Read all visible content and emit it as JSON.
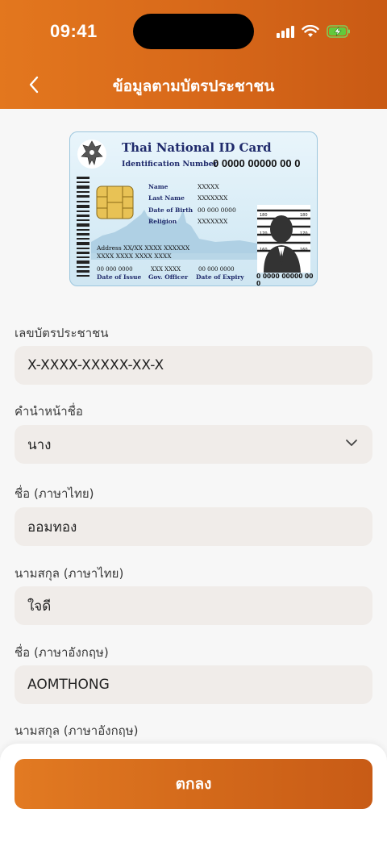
{
  "status_bar": {
    "time": "09:41"
  },
  "header": {
    "title": "ข้อมูลตามบัตรประชาชน"
  },
  "id_card": {
    "title": "Thai National ID Card",
    "id_label": "Identification Number",
    "id_number": "0 0000 00000 00 0",
    "name_label": "Name",
    "name_value": "XXXXX",
    "lastname_label": "Last Name",
    "lastname_value": "XXXXXXX",
    "dob_label": "Date of Birth",
    "dob_value": "00 000 0000",
    "religion_label": "Religion",
    "religion_value": "XXXXXXX",
    "address_line1": "Address XX/XX XXXX XXXXXX",
    "address_line2": "XXXX XXXX XXXX XXXX",
    "issue_value": "00 000 0000",
    "issue_label": "Date of Issue",
    "officer_value": "XXX XXXX",
    "officer_label": "Gov. Officer",
    "expiry_value": "00 000 0000",
    "expiry_label": "Date of Expiry",
    "bottom_number": "0 0000 00000 00 0",
    "height_marks": [
      "180",
      "180",
      "170",
      "170",
      "160",
      "160"
    ]
  },
  "form": {
    "id_number_label": "เลขบัตรประชาชน",
    "id_number_value": "X-XXXX-XXXXX-XX-X",
    "prefix_label": "คำนำหน้าชื่อ",
    "prefix_value": "นาง",
    "firstname_th_label": "ชื่อ (ภาษาไทย)",
    "firstname_th_value": "ออมทอง",
    "lastname_th_label": "นามสกุล (ภาษาไทย)",
    "lastname_th_value": "ใจดี",
    "firstname_en_label": "ชื่อ (ภาษาอังกฤษ)",
    "firstname_en_value": "AOMTHONG",
    "lastname_en_label": "นามสกุล (ภาษาอังกฤษ)"
  },
  "footer": {
    "confirm_label": "ตกลง"
  },
  "colors": {
    "brand_orange": "#d8691a",
    "field_bg": "#f0ece9",
    "card_navy": "#1f2a6b"
  }
}
